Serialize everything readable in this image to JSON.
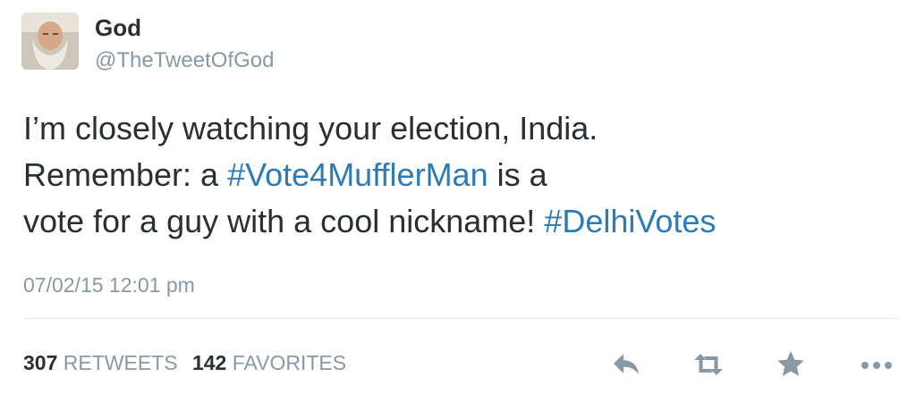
{
  "user": {
    "name": "God",
    "handle": "@TheTweetOfGod"
  },
  "tweet": {
    "line1": "I’m closely watching your election, India.",
    "line2_prefix": "Remember: a ",
    "line2_hashtag": "#Vote4MufflerMan",
    "line2_suffix": " is a",
    "line3_prefix": "vote for a guy with a cool nickname! ",
    "line3_hashtag": "#DelhiVotes",
    "timestamp": "07/02/15 12:01 pm"
  },
  "stats": {
    "retweets_count": "307",
    "retweets_label": "RETWEETS",
    "favorites_count": "142",
    "favorites_label": "FAVORITES"
  },
  "actions": [
    {
      "icon": "reply-icon"
    },
    {
      "icon": "retweet-icon"
    },
    {
      "icon": "favorite-star-icon"
    },
    {
      "icon": "more-dots-icon"
    }
  ],
  "colors": {
    "text": "#292f33",
    "secondary": "#8899a6",
    "hashtag": "#2b7bb9",
    "icon": "#8899a6",
    "divider": "#e1e8ed"
  }
}
